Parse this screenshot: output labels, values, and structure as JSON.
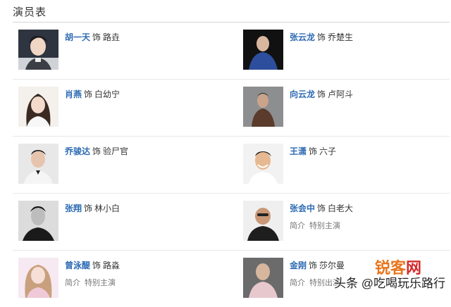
{
  "section_title": "演员表",
  "cast": [
    {
      "actor": "胡一天",
      "role": "路垚",
      "as": "饰"
    },
    {
      "actor": "张云龙",
      "role": "乔楚生",
      "as": "饰"
    },
    {
      "actor": "肖燕",
      "role": "白幼宁",
      "as": "饰"
    },
    {
      "actor": "向云龙",
      "role": "卢阿斗",
      "as": "饰"
    },
    {
      "actor": "乔骏达",
      "role": "验尸官",
      "as": "饰"
    },
    {
      "actor": "王潇",
      "role": "六子",
      "as": "饰"
    },
    {
      "actor": "张翔",
      "role": "林小白",
      "as": "饰"
    },
    {
      "actor": "张会中",
      "role": "白老大",
      "as": "饰",
      "intro": "简介",
      "tag": "特别主演"
    },
    {
      "actor": "曾泳醍",
      "role": "路淼",
      "as": "饰",
      "intro": "简介",
      "tag": "特别主演"
    },
    {
      "actor": "金刚",
      "role": "莎尔曼",
      "as": "饰",
      "intro": "简介",
      "tag": "特别出演"
    }
  ],
  "watermark": {
    "brand_a": "锐客",
    "brand_b": "网",
    "text": "头条 @吃喝玩乐路行"
  },
  "colors": {
    "name": "#2d6ab3",
    "divider": "#e8e8e8"
  }
}
